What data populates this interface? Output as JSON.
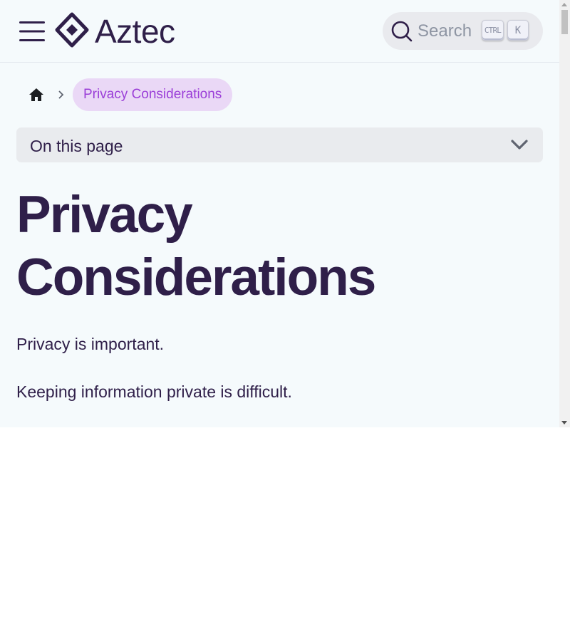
{
  "header": {
    "logo_text": "Aztec",
    "search": {
      "placeholder": "Search",
      "shortcut_modifier": "CTRL",
      "shortcut_key": "K"
    }
  },
  "breadcrumb": {
    "home_icon": "home-icon",
    "current": "Privacy Considerations"
  },
  "toc": {
    "label": "On this page"
  },
  "content": {
    "title_line_1": "Privacy",
    "title_line_2": "Considerations",
    "paragraphs": [
      "Privacy is important.",
      "Keeping information private is difficult."
    ]
  },
  "colors": {
    "text": "#2f1f49",
    "accent": "#9b3fd8",
    "accent_bg": "#ead8f6",
    "page_bg": "#f5fafc"
  }
}
